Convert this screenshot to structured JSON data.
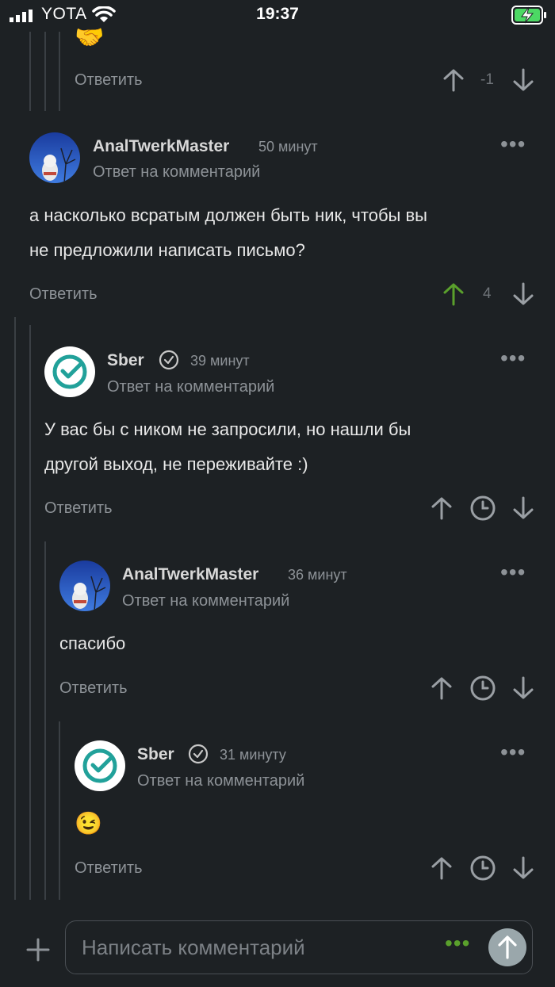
{
  "status_bar": {
    "carrier": "YOTA",
    "time": "19:37"
  },
  "top_partial": {
    "reply": "Ответить",
    "score": "-1"
  },
  "comments": [
    {
      "author": "AnalTwerkMaster",
      "ago": "50 минут",
      "reply_to": "Ответ на комментарий",
      "lines": [
        "а насколько всратым должен быть ник, чтобы вы",
        "не предложили написать письмо?"
      ],
      "reply": "Ответить",
      "score": "4"
    },
    {
      "author": "Sber",
      "ago": "39 минут",
      "reply_to": "Ответ на комментарий",
      "lines": [
        "У вас бы с ником не запросили, но нашли бы",
        "другой выход, не переживайте :)"
      ],
      "reply": "Ответить"
    },
    {
      "author": "AnalTwerkMaster",
      "ago": "36 минут",
      "reply_to": "Ответ на комментарий",
      "lines": [
        "спасибо"
      ],
      "reply": "Ответить"
    },
    {
      "author": "Sber",
      "ago": "31 минуту",
      "reply_to": "Ответ на комментарий",
      "lines": [
        "😉"
      ],
      "reply": "Ответить"
    }
  ],
  "composer": {
    "placeholder": "Написать комментарий"
  },
  "colors": {
    "background": "#1d2124",
    "upvote_active": "#5aa02c",
    "send_button": "#9aa7ab"
  }
}
